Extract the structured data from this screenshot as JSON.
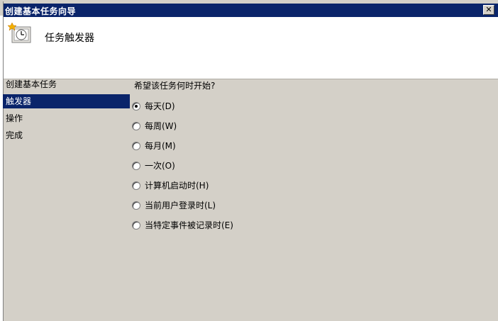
{
  "window": {
    "title": "创建基本任务向导",
    "close_glyph": "✕"
  },
  "header": {
    "icon": "clock-task-icon",
    "title": "任务触发器"
  },
  "nav": {
    "items": [
      {
        "label": "创建基本任务",
        "selected": false
      },
      {
        "label": "触发器",
        "selected": true
      },
      {
        "label": "操作",
        "selected": false
      },
      {
        "label": "完成",
        "selected": false
      }
    ]
  },
  "content": {
    "prompt": "希望该任务何时开始?",
    "options": [
      {
        "label": "每天(D)",
        "checked": true
      },
      {
        "label": "每周(W)",
        "checked": false
      },
      {
        "label": "每月(M)",
        "checked": false
      },
      {
        "label": "一次(O)",
        "checked": false
      },
      {
        "label": "计算机启动时(H)",
        "checked": false
      },
      {
        "label": "当前用户登录时(L)",
        "checked": false
      },
      {
        "label": "当特定事件被记录时(E)",
        "checked": false
      }
    ]
  },
  "colors": {
    "titlebar": "#0a246a",
    "selection": "#0a246a",
    "dialog_bg": "#d4d0c8"
  }
}
